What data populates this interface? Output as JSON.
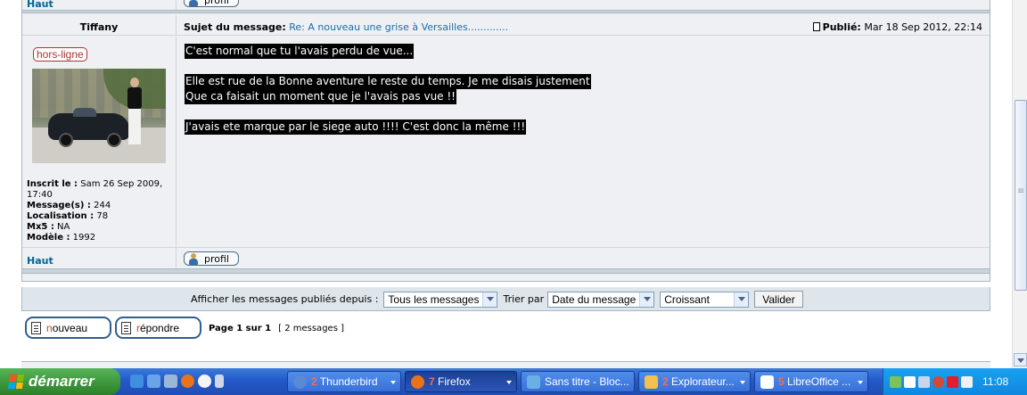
{
  "top_row": {
    "haut_label": "Haut",
    "profil_label": "profil"
  },
  "post": {
    "author": "Tiffany",
    "subject_label": "Sujet du message:",
    "subject": "Re: A nouveau une grise à Versailles.............",
    "published_label": "Publié:",
    "published_date": "Mar 18 Sep 2012, 22:14",
    "status": "hors-ligne",
    "user_info": {
      "joined_label": "Inscrit le :",
      "joined_value": "Sam 26 Sep 2009, 17:40",
      "messages_label": "Message(s) :",
      "messages_value": "244",
      "location_label": "Localisation :",
      "location_value": "78",
      "mx5_label": "Mx5 :",
      "mx5_value": "NA",
      "model_label": "Modèle :",
      "model_value": "1992"
    },
    "body_lines": [
      "C'est normal que tu l'avais perdu de vue...",
      "",
      "Elle est rue de la Bonne aventure le reste du temps. Je me disais justement",
      "Que ca faisait un moment que je l'avais pas vue !!",
      "",
      "J'avais ete marque par le siege auto !!!! C'est donc la même !!!"
    ],
    "haut_label": "Haut",
    "profil_label": "profil"
  },
  "filter": {
    "display_label": "Afficher les messages publiés depuis :",
    "display_value": "Tous les messages",
    "sort_label": "Trier par",
    "sort_value": "Date du message",
    "order_value": "Croissant",
    "submit_label": "Valider"
  },
  "nav": {
    "new_label_first": "n",
    "new_label_rest": "ouveau",
    "reply_label_first": "r",
    "reply_label_rest": "épondre",
    "page_info": "Page 1 sur 1",
    "count": "[ 2 messages ]"
  },
  "taskbar": {
    "start_label": "démarrer",
    "tasks": [
      {
        "num": "2",
        "label": "Thunderbird",
        "icon_color": "#5a8ad6"
      },
      {
        "num": "7",
        "label": "Firefox",
        "icon_color": "#e8731b"
      },
      {
        "num": "",
        "label": "Sans titre - Bloc...",
        "icon_color": "#6ab0e6"
      },
      {
        "num": "2",
        "label": "Explorateur...",
        "icon_color": "#f2c14e"
      },
      {
        "num": "5",
        "label": "LibreOffice ...",
        "icon_color": "#ffffff"
      }
    ],
    "clock": "11:08"
  },
  "colors": {
    "link": "#006597",
    "subject": "#1a6fa3",
    "panel": "#eef0f3",
    "taskbar": "#2459c9",
    "start": "#3a9438"
  }
}
